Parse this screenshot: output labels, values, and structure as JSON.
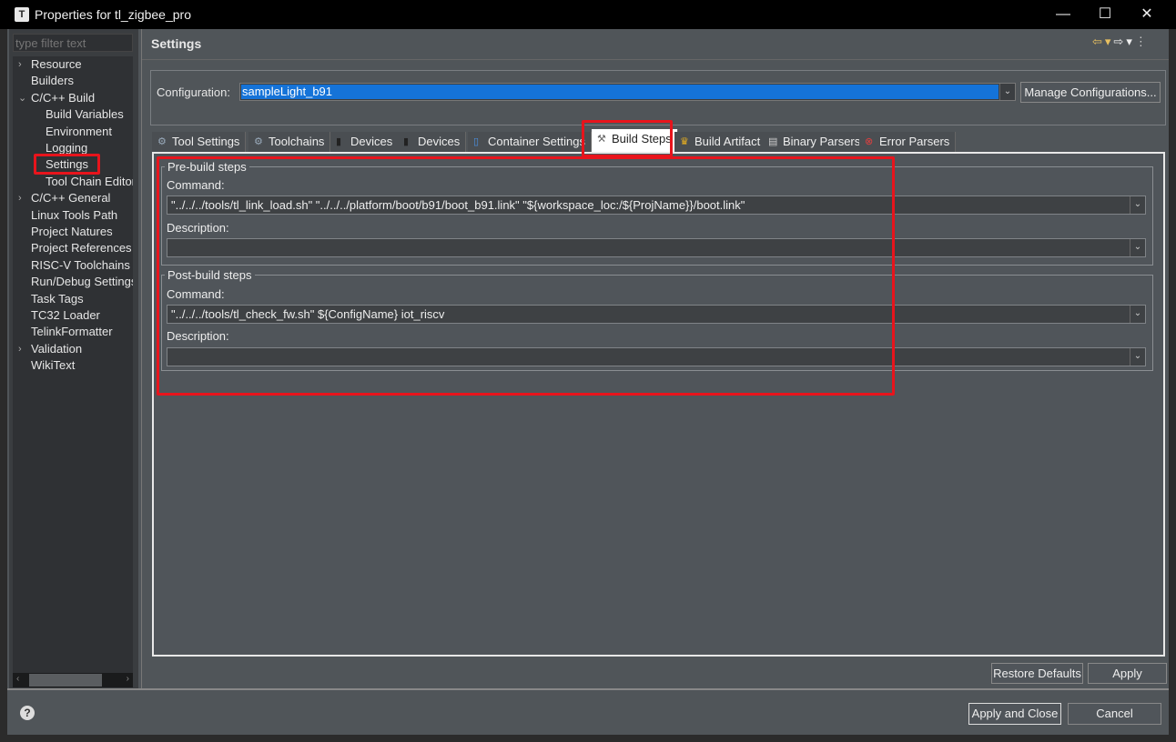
{
  "window": {
    "title": "Properties for tl_zigbee_pro",
    "icon": "T",
    "minimize": "—",
    "maximize": "☐",
    "close": "✕"
  },
  "sidebar": {
    "filter_placeholder": "type filter text",
    "items": [
      {
        "label": "Resource",
        "expander": "›",
        "level": 0
      },
      {
        "label": "Builders",
        "level": 0
      },
      {
        "label": "C/C++ Build",
        "expander": "⌄",
        "level": 0
      },
      {
        "label": "Build Variables",
        "level": 1
      },
      {
        "label": "Environment",
        "level": 1
      },
      {
        "label": "Logging",
        "level": 1
      },
      {
        "label": "Settings",
        "level": 1,
        "selected": true
      },
      {
        "label": "Tool Chain Editor",
        "level": 1
      },
      {
        "label": "C/C++ General",
        "expander": "›",
        "level": 0
      },
      {
        "label": "Linux Tools Path",
        "level": 0
      },
      {
        "label": "Project Natures",
        "level": 0
      },
      {
        "label": "Project References",
        "level": 0
      },
      {
        "label": "RISC-V Toolchains Paths",
        "level": 0
      },
      {
        "label": "Run/Debug Settings",
        "level": 0
      },
      {
        "label": "Task Tags",
        "level": 0
      },
      {
        "label": "TC32 Loader",
        "level": 0
      },
      {
        "label": "TelinkFormatter",
        "level": 0
      },
      {
        "label": "Validation",
        "expander": "›",
        "level": 0
      },
      {
        "label": "WikiText",
        "level": 0
      }
    ]
  },
  "header": {
    "title": "Settings"
  },
  "configuration": {
    "label": "Configuration:",
    "value": "sampleLight_b91",
    "manage_button": "Manage Configurations..."
  },
  "tabs": [
    {
      "label": "Tool Settings",
      "icon": "gear-icon",
      "glyph": "⚙",
      "color": "#9ab"
    },
    {
      "label": "Toolchains",
      "icon": "gear-icon",
      "glyph": "⚙",
      "color": "#9ab"
    },
    {
      "label": "Devices",
      "icon": "chip-icon",
      "glyph": "▮",
      "color": "#222"
    },
    {
      "label": "Devices",
      "icon": "chip-icon",
      "glyph": "▮",
      "color": "#222"
    },
    {
      "label": "Container Settings",
      "icon": "container-icon",
      "glyph": "▯",
      "color": "#4a90e2"
    },
    {
      "label": "Build Steps",
      "icon": "hammer-icon",
      "glyph": "⚒",
      "color": "#666",
      "selected": true
    },
    {
      "label": "Build Artifact",
      "icon": "trophy-icon",
      "glyph": "♛",
      "color": "#e8b020"
    },
    {
      "label": "Binary Parsers",
      "icon": "binary-icon",
      "glyph": "▤",
      "color": "#ccc"
    },
    {
      "label": "Error Parsers",
      "icon": "error-icon",
      "glyph": "⊗",
      "color": "#e04040"
    }
  ],
  "pre_build": {
    "legend": "Pre-build steps",
    "command_label": "Command:",
    "command": "\"../../../tools/tl_link_load.sh\" \"../../../platform/boot/b91/boot_b91.link\" \"${workspace_loc:/${ProjName}}/boot.link\"",
    "description_label": "Description:",
    "description": ""
  },
  "post_build": {
    "legend": "Post-build steps",
    "command_label": "Command:",
    "command": "\"../../../tools/tl_check_fw.sh\" ${ConfigName} iot_riscv",
    "description_label": "Description:",
    "description": ""
  },
  "buttons": {
    "restore_defaults": "Restore Defaults",
    "apply": "Apply",
    "apply_and_close": "Apply and Close",
    "cancel": "Cancel"
  },
  "highlight_color": "#e8141c"
}
